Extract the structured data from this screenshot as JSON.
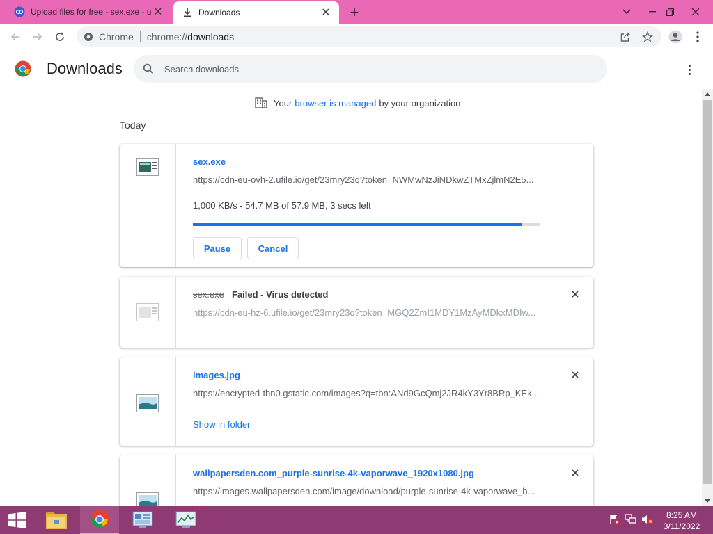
{
  "browser": {
    "tabs": [
      {
        "title": "Upload files for free - sex.exe - u",
        "active": false,
        "icon": "ufile-favicon"
      },
      {
        "title": "Downloads",
        "active": true,
        "icon": "download-icon"
      }
    ],
    "new_tab_label": "+",
    "omnibox": {
      "site_label": "Chrome",
      "url_scheme": "chrome://",
      "url_host": "downloads"
    },
    "tab_bar_color": "#e969b6"
  },
  "page": {
    "title": "Downloads",
    "search_placeholder": "Search downloads",
    "managed": {
      "prefix": "Your",
      "link": "browser is managed",
      "suffix": "by your organization"
    },
    "section": "Today"
  },
  "downloads": [
    {
      "name": "sex.exe",
      "source": "https://cdn-eu-ovh-2.ufile.io/get/23mry23q?token=NWMwNzJiNDkwZTMxZjlmN2E5...",
      "progress_text": "1,000 KB/s - 54.7 MB of 57.9 MB, 3 secs left",
      "progress": 0.945,
      "buttons": [
        "Pause",
        "Cancel"
      ],
      "state": "in_progress"
    },
    {
      "name": "sex.exe",
      "status": "Failed - Virus detected",
      "source": "https://cdn-eu-hz-6.ufile.io/get/23mry23q?token=MGQ2ZmI1MDY1MzAyMDkxMDIw...",
      "state": "failed"
    },
    {
      "name": "images.jpg",
      "source": "https://encrypted-tbn0.gstatic.com/images?q=tbn:ANd9GcQmj2JR4kY3Yr8BRp_KEk...",
      "link": "Show in folder",
      "state": "complete"
    },
    {
      "name": "wallpapersden.com_purple-sunrise-4k-vaporwave_1920x1080.jpg",
      "source": "https://images.wallpapersden.com/image/download/purple-sunrise-4k-vaporwave_b...",
      "state": "complete"
    }
  ],
  "taskbar": {
    "apps": [
      "file-explorer-icon",
      "chrome-icon",
      "control-panel-icon",
      "task-manager-icon"
    ],
    "active_app": "chrome-icon",
    "clock_time": "8:25 AM",
    "clock_date": "3/11/2022",
    "color": "#8f3a73"
  },
  "colors": {
    "accent": "#1a73e8",
    "text": "#202124",
    "muted": "#5f6368"
  }
}
